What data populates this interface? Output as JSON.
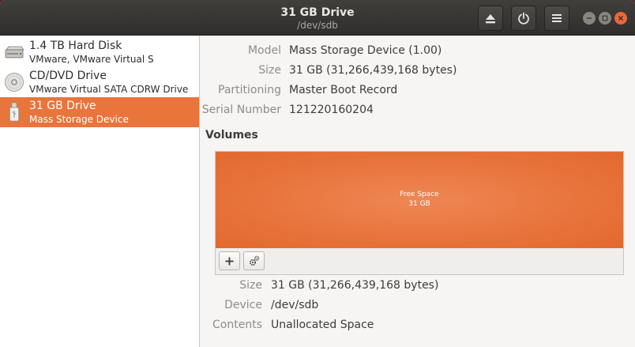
{
  "window": {
    "title": "31 GB Drive",
    "subtitle": "/dev/sdb"
  },
  "header_buttons": {
    "eject_icon": "eject-icon",
    "power_icon": "power-icon",
    "menu_icon": "hamburger-menu-icon"
  },
  "sidebar": {
    "drives": [
      {
        "name": "1.4 TB Hard Disk",
        "detail": "VMware, VMware Virtual S",
        "icon": "hard-disk-icon",
        "selected": false
      },
      {
        "name": "CD/DVD Drive",
        "detail": "VMware Virtual SATA CDRW Drive",
        "icon": "optical-disc-icon",
        "selected": false
      },
      {
        "name": "31 GB Drive",
        "detail": "Mass Storage Device",
        "icon": "usb-drive-icon",
        "selected": true
      }
    ]
  },
  "drive_properties": [
    {
      "label": "Model",
      "value": "Mass Storage Device (1.00)"
    },
    {
      "label": "Size",
      "value": "31 GB (31,266,439,168 bytes)"
    },
    {
      "label": "Partitioning",
      "value": "Master Boot Record"
    },
    {
      "label": "Serial Number",
      "value": "121220160204"
    }
  ],
  "volumes": {
    "heading": "Volumes",
    "block": {
      "line1": "Free Space",
      "line2": "31 GB"
    },
    "toolbar": {
      "add_icon": "plus-icon",
      "settings_icon": "gears-icon"
    },
    "properties": [
      {
        "label": "Size",
        "value": "31 GB (31,266,439,168 bytes)"
      },
      {
        "label": "Device",
        "value": "/dev/sdb"
      },
      {
        "label": "Contents",
        "value": "Unallocated Space"
      }
    ]
  },
  "colors": {
    "accent": "#e9743c",
    "headerbar": "#3a3937",
    "close_button": "#e9673a"
  }
}
